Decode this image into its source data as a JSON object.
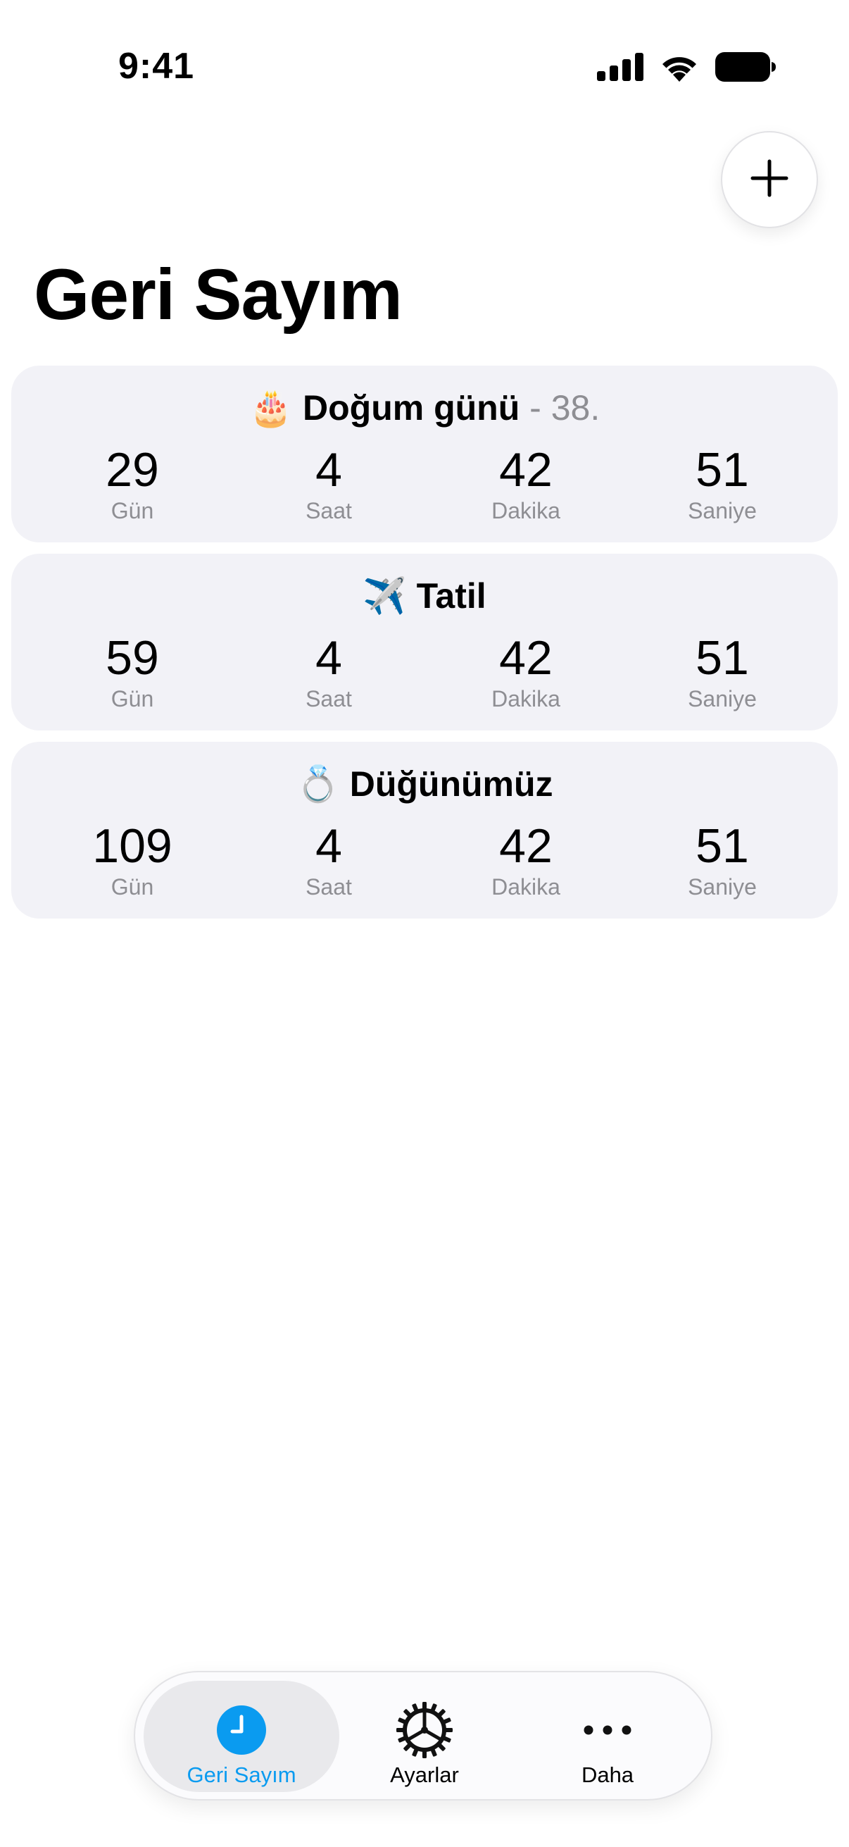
{
  "status_bar": {
    "time": "9:41",
    "icons": [
      "cellular-signal-icon",
      "wifi-icon",
      "battery-icon"
    ]
  },
  "header": {
    "add_icon": "plus-icon",
    "title": "Geri Sayım"
  },
  "countdowns": [
    {
      "emoji": "🎂",
      "title": "Doğum günü",
      "suffix": " - 38.",
      "days": "29",
      "hours": "4",
      "minutes": "42",
      "seconds": "51"
    },
    {
      "emoji": "✈️",
      "title": "Tatil",
      "suffix": "",
      "days": "59",
      "hours": "4",
      "minutes": "42",
      "seconds": "51"
    },
    {
      "emoji": "💍",
      "title": "Düğünümüz",
      "suffix": "",
      "days": "109",
      "hours": "4",
      "minutes": "42",
      "seconds": "51"
    }
  ],
  "unit_labels": {
    "days": "Gün",
    "hours": "Saat",
    "minutes": "Dakika",
    "seconds": "Saniye"
  },
  "tab_bar": {
    "active_color": "#0a9bf0",
    "tabs": [
      {
        "label": "Geri Sayım",
        "icon": "clock-icon",
        "active": true
      },
      {
        "label": "Ayarlar",
        "icon": "gear-icon",
        "active": false
      },
      {
        "label": "Daha",
        "icon": "more-icon",
        "active": false
      }
    ]
  }
}
